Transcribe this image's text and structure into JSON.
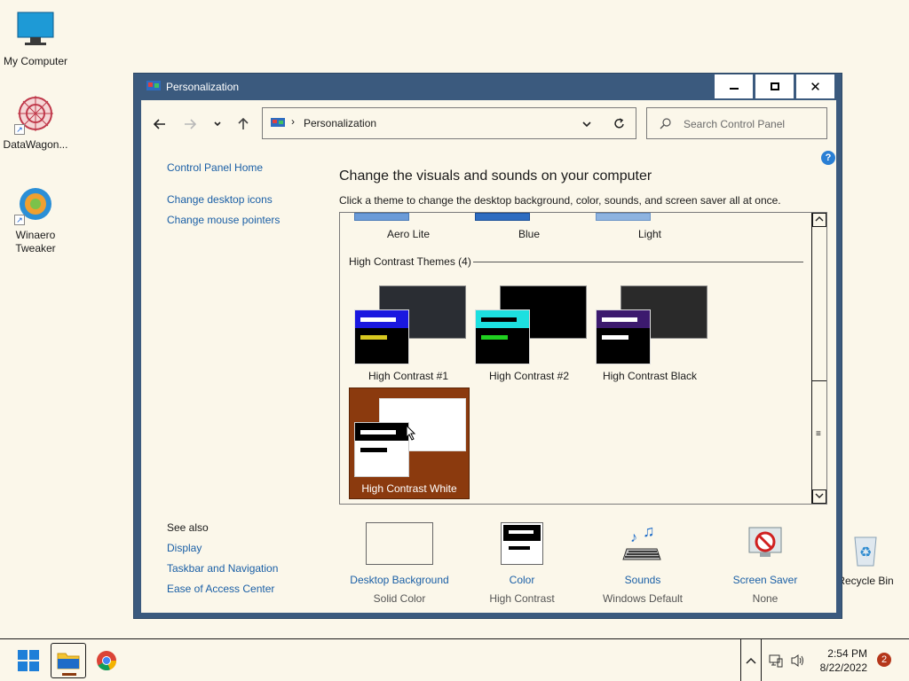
{
  "desktop": {
    "icons": [
      {
        "label": "My Computer"
      },
      {
        "label": "DataWagon..."
      },
      {
        "label": "Winaero Tweaker"
      },
      {
        "label": "Recycle Bin"
      }
    ]
  },
  "window": {
    "title": "Personalization",
    "controls": {
      "minimize": "—",
      "maximize": "☐",
      "close": "✕"
    }
  },
  "address_bar": {
    "breadcrumb": "Personalization",
    "search_placeholder": "Search Control Panel"
  },
  "left_pane": {
    "home": "Control Panel Home",
    "links": [
      "Change desktop icons",
      "Change mouse pointers"
    ],
    "see_also_title": "See also",
    "see_also": [
      "Display",
      "Taskbar and Navigation",
      "Ease of Access Center"
    ]
  },
  "main": {
    "heading": "Change the visuals and sounds on your computer",
    "subtitle": "Click a theme to change the desktop background, color, sounds, and screen saver all at once.",
    "top_themes": [
      "Aero Lite",
      "Blue",
      "Light"
    ],
    "group_title": "High Contrast Themes (4)",
    "hc_themes": [
      "High Contrast #1",
      "High Contrast #2",
      "High Contrast Black",
      "High Contrast White"
    ],
    "selected_theme": "High Contrast White"
  },
  "bottom": {
    "items": [
      {
        "label": "Desktop Background",
        "value": "Solid Color"
      },
      {
        "label": "Color",
        "value": "High Contrast"
      },
      {
        "label": "Sounds",
        "value": "Windows Default"
      },
      {
        "label": "Screen Saver",
        "value": "None"
      }
    ]
  },
  "taskbar": {
    "time": "2:54 PM",
    "date": "8/22/2022",
    "notification_count": "2"
  },
  "colors": {
    "window_frame": "#3b5a7e",
    "background": "#fbf7ea",
    "link": "#1a5fa6",
    "selected_theme": "#8b3a0e"
  }
}
